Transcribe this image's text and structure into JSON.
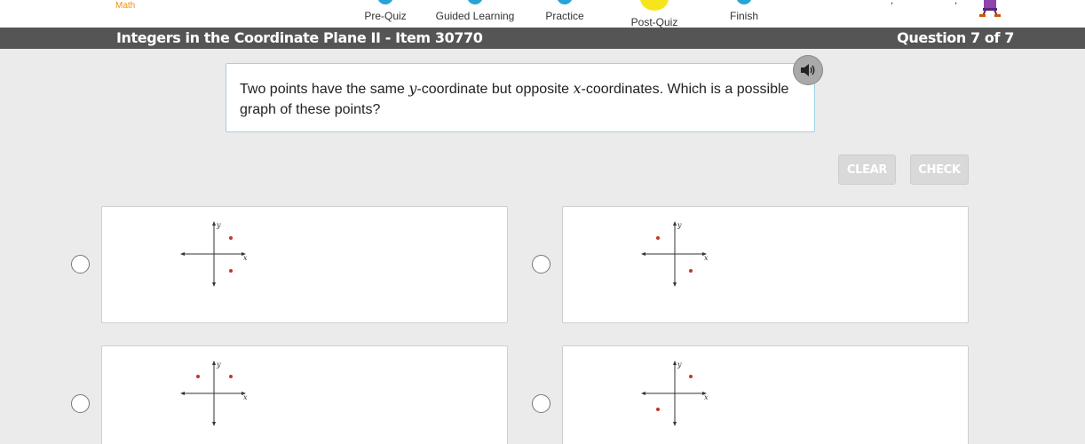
{
  "nav": {
    "subject": "Math",
    "steps": [
      {
        "label": "Pre-Quiz"
      },
      {
        "label": "Guided Learning"
      },
      {
        "label": "Practice"
      },
      {
        "label": "Post-Quiz"
      },
      {
        "label": "Finish"
      }
    ]
  },
  "header": {
    "title": "Integers in the Coordinate Plane II - Item 30770",
    "question_counter": "Question 7 of 7"
  },
  "question": {
    "text_part1": "Two points have the same ",
    "var_y": "y",
    "text_part2": "-coordinate but opposite ",
    "var_x": "x",
    "text_part3": "-coordinates. Which is a possible graph of these points?"
  },
  "buttons": {
    "clear": "CLEAR",
    "check": "CHECK"
  },
  "options": [
    {
      "axis_x": "x",
      "axis_y": "y"
    },
    {
      "axis_x": "x",
      "axis_y": "y"
    },
    {
      "axis_x": "x",
      "axis_y": "y"
    },
    {
      "axis_x": "x",
      "axis_y": "y"
    }
  ],
  "colors": {
    "title_bar": "#555555",
    "nav_dot": "#29a3d6",
    "nav_dot_current": "#f5e51a",
    "subject": "#e8940f",
    "point": "#c0392b"
  }
}
